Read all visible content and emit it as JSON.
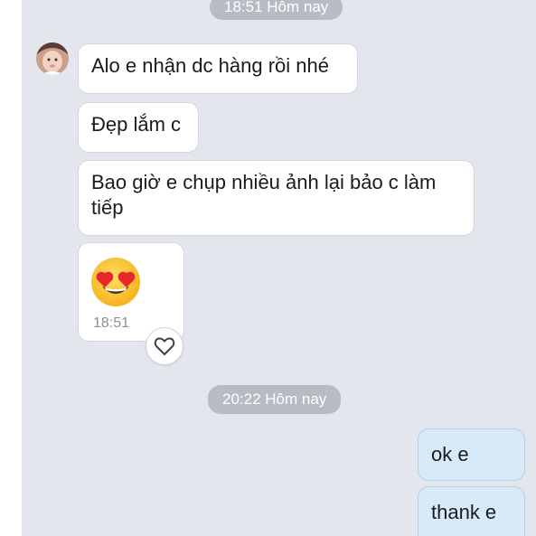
{
  "conversation": {
    "time_separator_1": "18:51 Hôm nay",
    "time_separator_2": "20:22 Hôm nay",
    "incoming": [
      {
        "text": "Alo e nhận dc hàng rồi nhé"
      },
      {
        "text": "Đẹp lắm c"
      },
      {
        "text": "Bao giờ e chụp nhiều ảnh lại bảo c làm tiếp"
      }
    ],
    "sticker": {
      "icon": "heart-eyes-emoji-icon",
      "time": "18:51",
      "reaction_icon": "heart-icon"
    },
    "outgoing": [
      {
        "text": "ok e"
      },
      {
        "text": "thank e"
      }
    ]
  },
  "colors": {
    "background": "#e4e6ee",
    "incoming_bubble": "#ffffff",
    "outgoing_bubble": "#d6eafa",
    "time_pill": "#b8bbc3"
  }
}
